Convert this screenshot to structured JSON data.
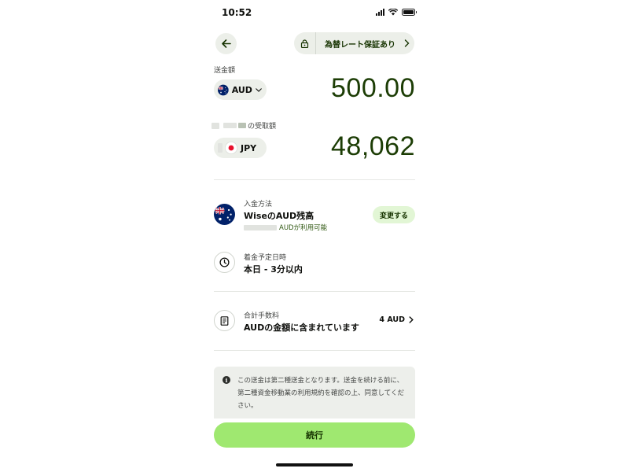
{
  "status_bar": {
    "time": "10:52"
  },
  "header": {
    "rate_guarantee_label": "為替レート保証あり"
  },
  "send": {
    "label": "送金額",
    "currency": "AUD",
    "amount": "500.00"
  },
  "receive": {
    "label_suffix": "の受取額",
    "currency": "JPY",
    "amount": "48,062"
  },
  "payment_method": {
    "caption": "入金方法",
    "title": "WiseのAUD残高",
    "available": "AUDが利用可能",
    "change_label": "変更する"
  },
  "arrival": {
    "caption": "着金予定日時",
    "value": "本日 - 3分以内"
  },
  "fees": {
    "caption": "合計手数料",
    "value": "AUDの金額に含まれています",
    "amount": "4 AUD"
  },
  "notice": {
    "text": "この送金は第二種送金となります。送金を続ける前に、第二種資金移動業の利用規約を確認の上、同意してください。"
  },
  "continue_label": "続行",
  "colors": {
    "brand_green": "#9fe870",
    "amount_green": "#1c3d05",
    "pill_grey": "#ecefe9",
    "change_bg": "#e2f6d5"
  },
  "icons": {
    "back": "arrow-left-icon",
    "lock": "lock-icon",
    "clock": "clock-icon",
    "receipt": "receipt-icon",
    "info": "info-icon"
  }
}
